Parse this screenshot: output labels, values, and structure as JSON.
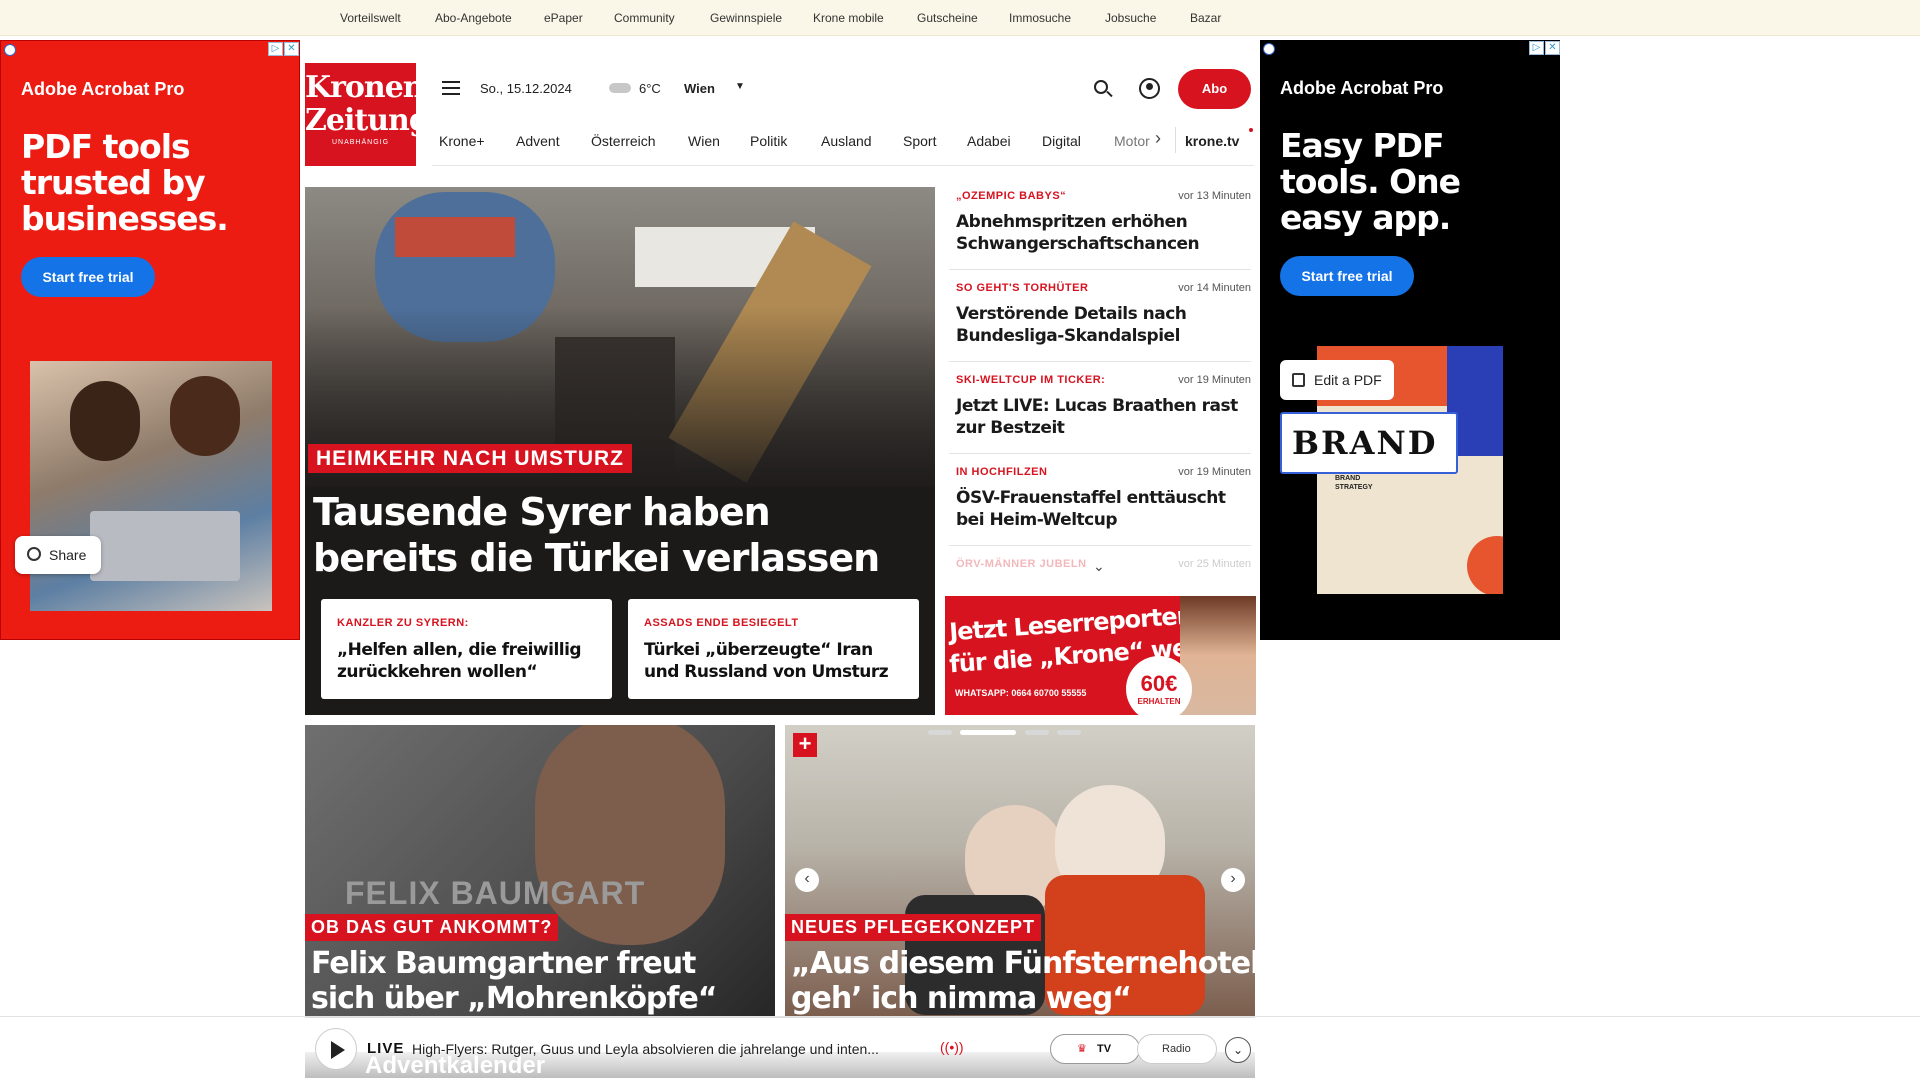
{
  "topnav": [
    "Vorteilswelt",
    "Abo-Angebote",
    "ePaper",
    "Community",
    "Gewinnspiele",
    "Krone mobile",
    "Gutscheine",
    "Immosuche",
    "Jobsuche",
    "Bazar"
  ],
  "ad_left": {
    "brand": "Adobe Acrobat Pro",
    "headline": "PDF tools trusted by businesses.",
    "cta": "Start free trial",
    "share": "Share"
  },
  "ad_right": {
    "brand": "Adobe Acrobat Pro",
    "headline": "Easy PDF tools. One easy app.",
    "cta": "Start free trial",
    "edit": "Edit a PDF",
    "brand_word": "BRAND",
    "doc_title": "BRAND STRATEGY"
  },
  "logo": {
    "line1": "Kronen",
    "line2": "Zeitung",
    "tagline": "UNABHÄNGIG"
  },
  "header": {
    "date": "So., 15.12.2024",
    "temp": "6°C",
    "location": "Wien",
    "abo": "Abo"
  },
  "nav": [
    "Krone+",
    "Advent",
    "Österreich",
    "Wien",
    "Politik",
    "Ausland",
    "Sport",
    "Adabei",
    "Digital",
    "Motor",
    "krone.tv"
  ],
  "hero": {
    "kicker": "HEIMKEHR NACH UMSTURZ",
    "title_line1": "Tausende Syrer haben",
    "title_line2": "bereits die Türkei verlassen",
    "sub1": {
      "kicker": "KANZLER ZU SYRERN:",
      "title": "„Helfen allen, die freiwillig zurückkehren wollen“"
    },
    "sub2": {
      "kicker": "ASSADS ENDE BESIEGELT",
      "title": "Türkei „überzeugte“ Iran und Russland von Umsturz"
    }
  },
  "news": [
    {
      "kicker": "„OZEMPIC BABYS“",
      "time": "vor 13 Minuten",
      "title": "Abnehmspritzen erhöhen Schwangerschaftschancen"
    },
    {
      "kicker": "SO GEHT'S TORHÜTER",
      "time": "vor 14 Minuten",
      "title": "Verstörende Details nach Bundesliga-Skandalspiel"
    },
    {
      "kicker": "SKI-WELTCUP IM TICKER:",
      "time": "vor 19 Minuten",
      "title": "Jetzt LIVE: Lucas Braathen rast zur Bestzeit"
    },
    {
      "kicker": "IN HOCHFILZEN",
      "time": "vor 19 Minuten",
      "title": "ÖSV-Frauenstaffel enttäuscht bei Heim-Weltcup"
    },
    {
      "kicker": "ÖRV-MÄNNER JUBELN",
      "time": "vor 25 Minuten",
      "title": ""
    }
  ],
  "leserreporter": {
    "line1": "Jetzt Leserreporter",
    "line2": "für die „Krone“ werden",
    "whatsapp": "WHATSAPP: 0664 60700 55555",
    "amount": "60€",
    "erhalten": "ERHALTEN"
  },
  "cards": [
    {
      "kicker": "OB DAS GUT ANKOMMT?",
      "title_line1": "Felix Baumgartner freut",
      "title_line2": "sich über „Mohrenköpfe“",
      "img_text": "FELIX BAUMGART"
    },
    {
      "kicker": "NEUES PFLEGEKONZEPT",
      "title_line1": "„Aus diesem Fünfsternehotel",
      "title_line2": "geh’ ich nimma weg“",
      "plus": "+"
    }
  ],
  "live": {
    "label": "LIVE",
    "text": "High-Flyers: Rutger, Guus und Leyla absolvieren die jahrelange und inten...",
    "tv": "TV",
    "radio": "Radio",
    "below": "Adventkalender"
  },
  "colors": {
    "brand_red": "#d6131f",
    "ad_red": "#ec1c13",
    "topbar": "#fbf7e8",
    "acrobat_blue": "#1473e6"
  }
}
